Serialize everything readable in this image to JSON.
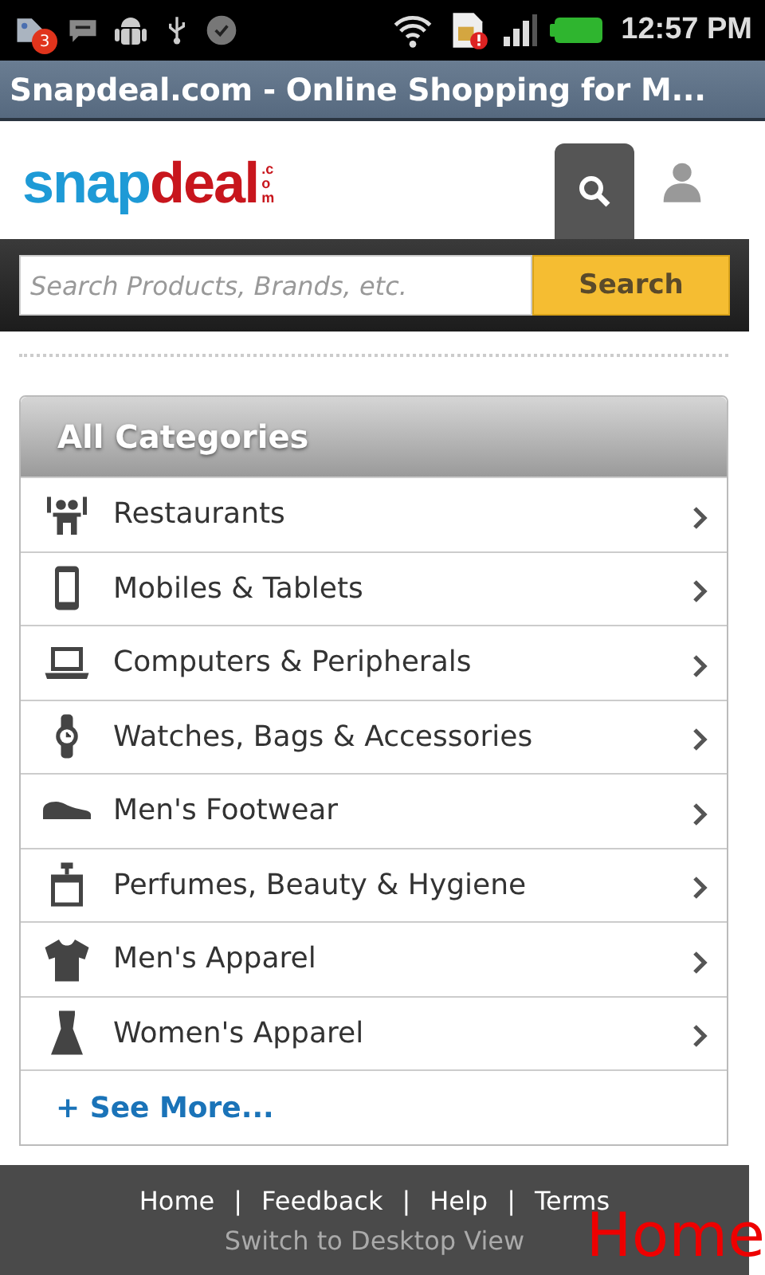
{
  "status_bar": {
    "notification_count": "3",
    "time": "12:57 PM"
  },
  "window": {
    "title": "Snapdeal.com - Online Shopping for M..."
  },
  "logo": {
    "first": "snap",
    "second": "deal",
    "suffix": ".com"
  },
  "search": {
    "placeholder": "Search Products, Brands, etc.",
    "button": "Search"
  },
  "categories": {
    "title": "All Categories",
    "items": [
      {
        "label": "Restaurants"
      },
      {
        "label": "Mobiles & Tablets"
      },
      {
        "label": "Computers & Peripherals"
      },
      {
        "label": "Watches, Bags & Accessories"
      },
      {
        "label": "Men's Footwear"
      },
      {
        "label": "Perfumes, Beauty & Hygiene"
      },
      {
        "label": "Men's Apparel"
      },
      {
        "label": "Women's Apparel"
      }
    ],
    "more": "+ See More..."
  },
  "footer": {
    "links": [
      "Home",
      "Feedback",
      "Help",
      "Terms"
    ],
    "separator": "|",
    "desktop_link": "Switch to Desktop View"
  },
  "overlay_label": "Home"
}
